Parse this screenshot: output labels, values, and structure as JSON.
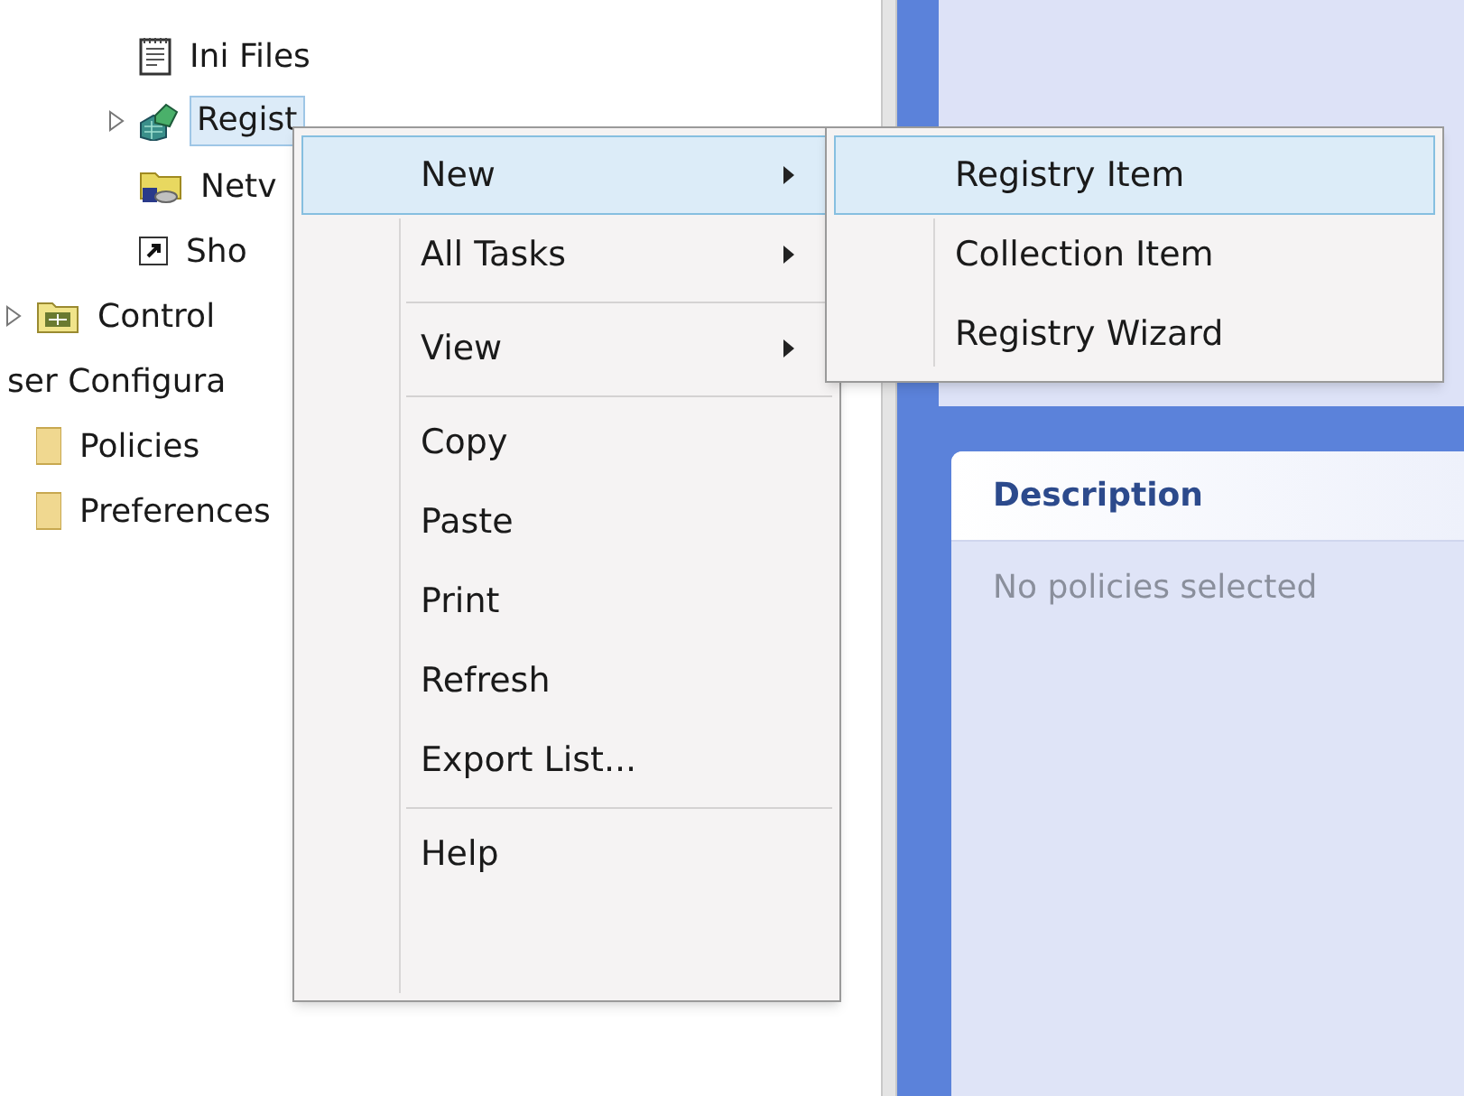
{
  "tree": [
    {
      "children": [
        {
          "label": "Ini Files",
          "kind": "ini",
          "expandable": false,
          "selected": false
        },
        {
          "label": "Regist",
          "kind": "registry",
          "expandable": true,
          "selected": true
        },
        {
          "label": "Netv",
          "kind": "network",
          "expandable": false,
          "selected": false
        },
        {
          "label": "Sho",
          "kind": "shortcut",
          "expandable": false,
          "selected": false
        }
      ]
    },
    {
      "label": "Control",
      "kind": "control",
      "expandable": true,
      "selected": false
    },
    {
      "label": "ser Configura",
      "kind": "plain",
      "expandable": false,
      "selected": false,
      "children": [
        {
          "label": "Policies",
          "kind": "folder",
          "expandable": false,
          "selected": false
        },
        {
          "label": "Preferences",
          "kind": "folder",
          "expandable": false,
          "selected": false
        }
      ]
    }
  ],
  "description": {
    "title": "Description",
    "text": "No policies selected"
  },
  "context_menu": [
    {
      "kind": "item",
      "label": "New",
      "submenu": true,
      "selected": true
    },
    {
      "kind": "item",
      "label": "All Tasks",
      "submenu": true,
      "selected": false
    },
    {
      "kind": "separator"
    },
    {
      "kind": "item",
      "label": "View",
      "submenu": true,
      "selected": false
    },
    {
      "kind": "separator"
    },
    {
      "kind": "item",
      "label": "Copy",
      "submenu": false,
      "selected": false
    },
    {
      "kind": "item",
      "label": "Paste",
      "submenu": false,
      "selected": false
    },
    {
      "kind": "item",
      "label": "Print",
      "submenu": false,
      "selected": false
    },
    {
      "kind": "item",
      "label": "Refresh",
      "submenu": false,
      "selected": false
    },
    {
      "kind": "item",
      "label": "Export List...",
      "submenu": false,
      "selected": false
    },
    {
      "kind": "separator"
    },
    {
      "kind": "item",
      "label": "Help",
      "submenu": false,
      "selected": false
    }
  ],
  "submenu": [
    {
      "label": "Registry Item",
      "selected": true
    },
    {
      "label": "Collection Item",
      "selected": false
    },
    {
      "label": "Registry Wizard",
      "selected": false
    }
  ]
}
